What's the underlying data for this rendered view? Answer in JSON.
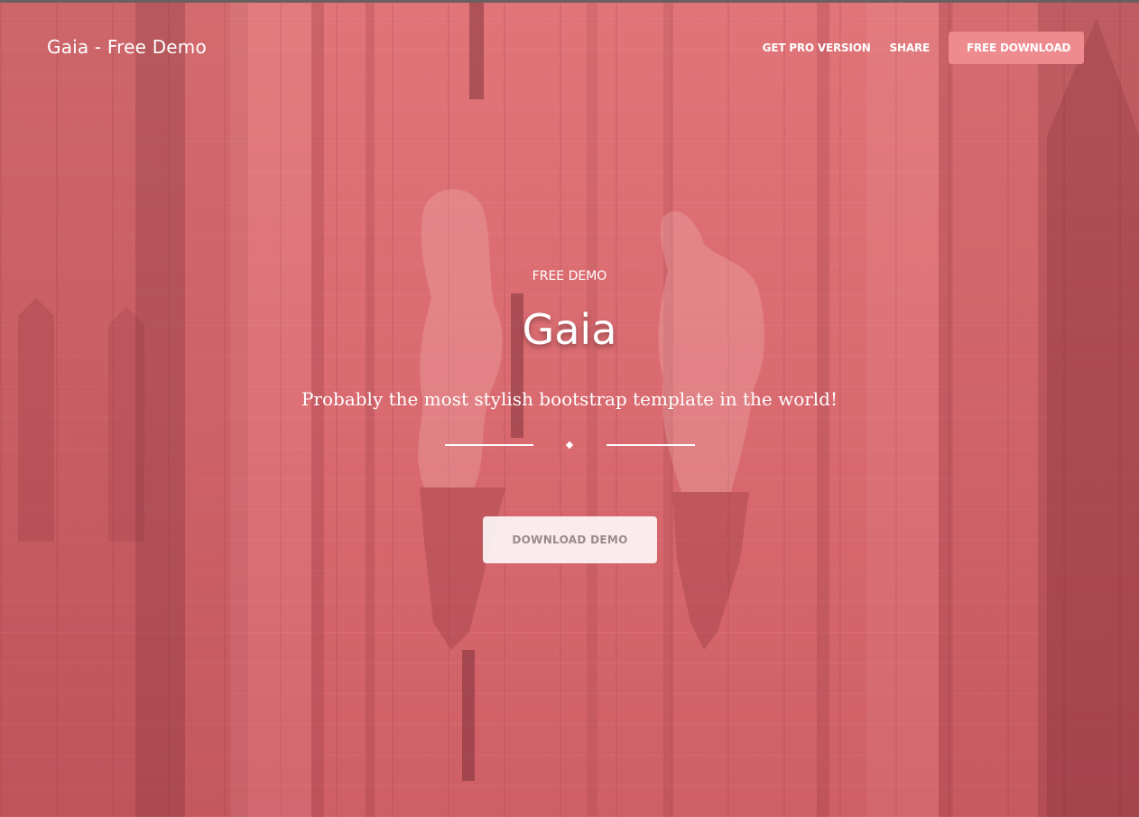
{
  "navbar": {
    "brand": "Gaia - Free Demo",
    "links": [
      {
        "label": "GET PRO VERSION"
      },
      {
        "label": "SHARE"
      }
    ],
    "cta_label": "FREE DOWNLOAD"
  },
  "hero": {
    "eyebrow": "FREE DEMO",
    "title": "Gaia",
    "tagline": "Probably the most stylish bootstrap template in the world!",
    "button_label": "DOWNLOAD DEMO"
  },
  "colors": {
    "overlay": "#d9686f",
    "nav_button": "#ee8b8f",
    "text": "#ffffff",
    "demo_button_text": "#9a8a8a"
  }
}
